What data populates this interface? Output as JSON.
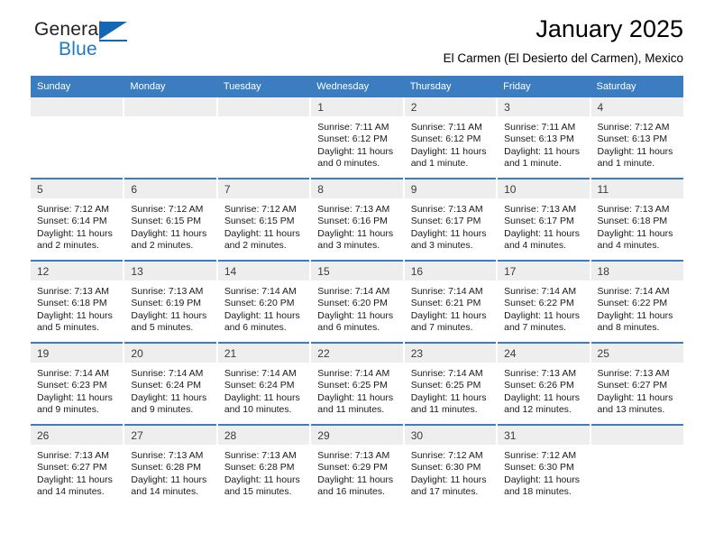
{
  "brand": {
    "name_part1": "General",
    "name_part2": "Blue",
    "accent_color": "#1268b3"
  },
  "header": {
    "title": "January 2025",
    "subtitle": "El Carmen (El Desierto del Carmen), Mexico"
  },
  "calendar": {
    "header_bg": "#3b7dc0",
    "daynum_bg": "#eeeeee",
    "weekdays": [
      "Sunday",
      "Monday",
      "Tuesday",
      "Wednesday",
      "Thursday",
      "Friday",
      "Saturday"
    ],
    "weeks": [
      [
        {
          "day": "",
          "sunrise": "",
          "sunset": "",
          "daylight": "",
          "empty": true
        },
        {
          "day": "",
          "sunrise": "",
          "sunset": "",
          "daylight": "",
          "empty": true
        },
        {
          "day": "",
          "sunrise": "",
          "sunset": "",
          "daylight": "",
          "empty": true
        },
        {
          "day": "1",
          "sunrise": "Sunrise: 7:11 AM",
          "sunset": "Sunset: 6:12 PM",
          "daylight": "Daylight: 11 hours and 0 minutes.",
          "empty": false
        },
        {
          "day": "2",
          "sunrise": "Sunrise: 7:11 AM",
          "sunset": "Sunset: 6:12 PM",
          "daylight": "Daylight: 11 hours and 1 minute.",
          "empty": false
        },
        {
          "day": "3",
          "sunrise": "Sunrise: 7:11 AM",
          "sunset": "Sunset: 6:13 PM",
          "daylight": "Daylight: 11 hours and 1 minute.",
          "empty": false
        },
        {
          "day": "4",
          "sunrise": "Sunrise: 7:12 AM",
          "sunset": "Sunset: 6:13 PM",
          "daylight": "Daylight: 11 hours and 1 minute.",
          "empty": false
        }
      ],
      [
        {
          "day": "5",
          "sunrise": "Sunrise: 7:12 AM",
          "sunset": "Sunset: 6:14 PM",
          "daylight": "Daylight: 11 hours and 2 minutes.",
          "empty": false
        },
        {
          "day": "6",
          "sunrise": "Sunrise: 7:12 AM",
          "sunset": "Sunset: 6:15 PM",
          "daylight": "Daylight: 11 hours and 2 minutes.",
          "empty": false
        },
        {
          "day": "7",
          "sunrise": "Sunrise: 7:12 AM",
          "sunset": "Sunset: 6:15 PM",
          "daylight": "Daylight: 11 hours and 2 minutes.",
          "empty": false
        },
        {
          "day": "8",
          "sunrise": "Sunrise: 7:13 AM",
          "sunset": "Sunset: 6:16 PM",
          "daylight": "Daylight: 11 hours and 3 minutes.",
          "empty": false
        },
        {
          "day": "9",
          "sunrise": "Sunrise: 7:13 AM",
          "sunset": "Sunset: 6:17 PM",
          "daylight": "Daylight: 11 hours and 3 minutes.",
          "empty": false
        },
        {
          "day": "10",
          "sunrise": "Sunrise: 7:13 AM",
          "sunset": "Sunset: 6:17 PM",
          "daylight": "Daylight: 11 hours and 4 minutes.",
          "empty": false
        },
        {
          "day": "11",
          "sunrise": "Sunrise: 7:13 AM",
          "sunset": "Sunset: 6:18 PM",
          "daylight": "Daylight: 11 hours and 4 minutes.",
          "empty": false
        }
      ],
      [
        {
          "day": "12",
          "sunrise": "Sunrise: 7:13 AM",
          "sunset": "Sunset: 6:18 PM",
          "daylight": "Daylight: 11 hours and 5 minutes.",
          "empty": false
        },
        {
          "day": "13",
          "sunrise": "Sunrise: 7:13 AM",
          "sunset": "Sunset: 6:19 PM",
          "daylight": "Daylight: 11 hours and 5 minutes.",
          "empty": false
        },
        {
          "day": "14",
          "sunrise": "Sunrise: 7:14 AM",
          "sunset": "Sunset: 6:20 PM",
          "daylight": "Daylight: 11 hours and 6 minutes.",
          "empty": false
        },
        {
          "day": "15",
          "sunrise": "Sunrise: 7:14 AM",
          "sunset": "Sunset: 6:20 PM",
          "daylight": "Daylight: 11 hours and 6 minutes.",
          "empty": false
        },
        {
          "day": "16",
          "sunrise": "Sunrise: 7:14 AM",
          "sunset": "Sunset: 6:21 PM",
          "daylight": "Daylight: 11 hours and 7 minutes.",
          "empty": false
        },
        {
          "day": "17",
          "sunrise": "Sunrise: 7:14 AM",
          "sunset": "Sunset: 6:22 PM",
          "daylight": "Daylight: 11 hours and 7 minutes.",
          "empty": false
        },
        {
          "day": "18",
          "sunrise": "Sunrise: 7:14 AM",
          "sunset": "Sunset: 6:22 PM",
          "daylight": "Daylight: 11 hours and 8 minutes.",
          "empty": false
        }
      ],
      [
        {
          "day": "19",
          "sunrise": "Sunrise: 7:14 AM",
          "sunset": "Sunset: 6:23 PM",
          "daylight": "Daylight: 11 hours and 9 minutes.",
          "empty": false
        },
        {
          "day": "20",
          "sunrise": "Sunrise: 7:14 AM",
          "sunset": "Sunset: 6:24 PM",
          "daylight": "Daylight: 11 hours and 9 minutes.",
          "empty": false
        },
        {
          "day": "21",
          "sunrise": "Sunrise: 7:14 AM",
          "sunset": "Sunset: 6:24 PM",
          "daylight": "Daylight: 11 hours and 10 minutes.",
          "empty": false
        },
        {
          "day": "22",
          "sunrise": "Sunrise: 7:14 AM",
          "sunset": "Sunset: 6:25 PM",
          "daylight": "Daylight: 11 hours and 11 minutes.",
          "empty": false
        },
        {
          "day": "23",
          "sunrise": "Sunrise: 7:14 AM",
          "sunset": "Sunset: 6:25 PM",
          "daylight": "Daylight: 11 hours and 11 minutes.",
          "empty": false
        },
        {
          "day": "24",
          "sunrise": "Sunrise: 7:13 AM",
          "sunset": "Sunset: 6:26 PM",
          "daylight": "Daylight: 11 hours and 12 minutes.",
          "empty": false
        },
        {
          "day": "25",
          "sunrise": "Sunrise: 7:13 AM",
          "sunset": "Sunset: 6:27 PM",
          "daylight": "Daylight: 11 hours and 13 minutes.",
          "empty": false
        }
      ],
      [
        {
          "day": "26",
          "sunrise": "Sunrise: 7:13 AM",
          "sunset": "Sunset: 6:27 PM",
          "daylight": "Daylight: 11 hours and 14 minutes.",
          "empty": false
        },
        {
          "day": "27",
          "sunrise": "Sunrise: 7:13 AM",
          "sunset": "Sunset: 6:28 PM",
          "daylight": "Daylight: 11 hours and 14 minutes.",
          "empty": false
        },
        {
          "day": "28",
          "sunrise": "Sunrise: 7:13 AM",
          "sunset": "Sunset: 6:28 PM",
          "daylight": "Daylight: 11 hours and 15 minutes.",
          "empty": false
        },
        {
          "day": "29",
          "sunrise": "Sunrise: 7:13 AM",
          "sunset": "Sunset: 6:29 PM",
          "daylight": "Daylight: 11 hours and 16 minutes.",
          "empty": false
        },
        {
          "day": "30",
          "sunrise": "Sunrise: 7:12 AM",
          "sunset": "Sunset: 6:30 PM",
          "daylight": "Daylight: 11 hours and 17 minutes.",
          "empty": false
        },
        {
          "day": "31",
          "sunrise": "Sunrise: 7:12 AM",
          "sunset": "Sunset: 6:30 PM",
          "daylight": "Daylight: 11 hours and 18 minutes.",
          "empty": false
        },
        {
          "day": "",
          "sunrise": "",
          "sunset": "",
          "daylight": "",
          "empty": true
        }
      ]
    ]
  }
}
